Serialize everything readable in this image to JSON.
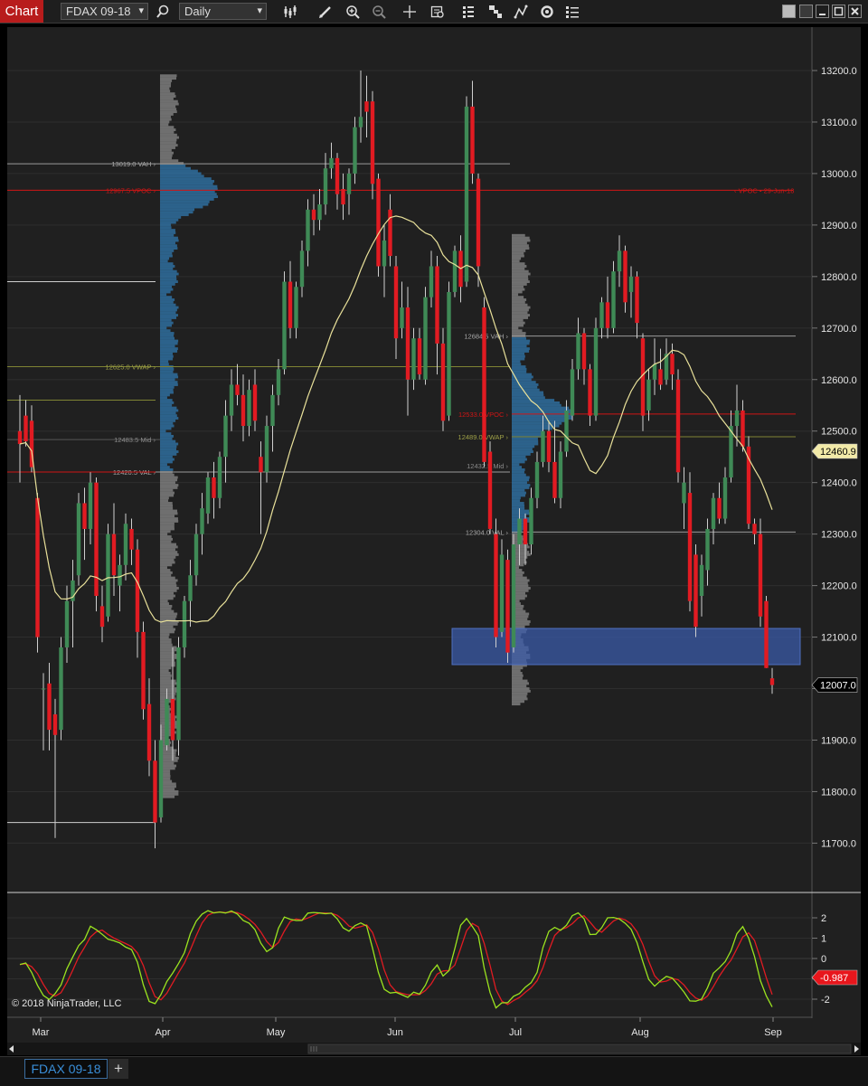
{
  "toolbar": {
    "chart_label": "Chart",
    "instrument": "FDAX 09-18",
    "interval": "Daily",
    "icons": [
      "search-icon",
      "bar-type-icon",
      "pencil-icon",
      "zoom-in-icon",
      "zoom-out-icon",
      "crosshair-icon",
      "data-box-icon",
      "strategies-icon",
      "indicators-icon",
      "drawing-tools-icon",
      "reload-icon",
      "properties-icon"
    ]
  },
  "window": {
    "buttons": [
      "tile-icon",
      "minimize-icon",
      "maximize-icon",
      "close-icon"
    ]
  },
  "tabs": [
    {
      "label": "FDAX 09-18"
    }
  ],
  "tab_add": "+",
  "colors": {
    "up": "#3f8a56",
    "down": "#e11b22",
    "sma": "#e9e19a",
    "vwap": "#7f8433",
    "poc": "#d01515",
    "value_area": "#2f6f9f",
    "zone": "#3a5aa7"
  },
  "chart_data": {
    "type": "candlestick",
    "interval": "Daily",
    "price_axis": {
      "ticks": [
        13200,
        13100,
        13000,
        12900,
        12800,
        12700,
        12600,
        12500,
        12400,
        12300,
        12200,
        12100,
        12000,
        11900,
        11800,
        11700
      ],
      "labels": [
        "13200.0",
        "13100.0",
        "13000.0",
        "12900.0",
        "12800.0",
        "12700.0",
        "12600.0",
        "12500.0",
        "12400.0",
        "12300.0",
        "12200.0",
        "12100.0",
        "12000.0",
        "11900.0",
        "11800.0",
        "11700.0"
      ]
    },
    "time_axis": {
      "labels": [
        "Mar",
        "Apr",
        "May",
        "Jun",
        "Jul",
        "Aug",
        "Sep"
      ]
    },
    "markers": {
      "ma_value": "12460.9",
      "last_price": "12007.0",
      "oscillator_value": "-0.987"
    },
    "profile_labels": {
      "p1_vah": "13019.0 VAH",
      "p1_vpoc": "12967.5 VPOC",
      "p1_vwap": "12625.0 VWAP",
      "p1_mid": "12483.5 Mid",
      "p1_val": "12420.5 VAL",
      "p2_vah": "12684.5 VAH",
      "p2_vpoc": "12533.0 VPOC",
      "p2_vwap": "12489.0 VWAP",
      "p2_mid": "12432.5 Mid",
      "p2_val": "12304.0 VAL",
      "naked_vpoc": "VPOC • 29-Jun-18"
    },
    "oscillator_axis": {
      "ticks": [
        2,
        1,
        0,
        -1,
        -2
      ],
      "labels": [
        "2",
        "1",
        "0",
        "-1",
        "-2"
      ]
    },
    "copyright": "© 2018 NinjaTrader, LLC",
    "candles": [
      {
        "o": 12500,
        "h": 12570,
        "l": 12400,
        "c": 12475
      },
      {
        "o": 12530,
        "h": 12560,
        "l": 12470,
        "c": 12480
      },
      {
        "o": 12520,
        "h": 12550,
        "l": 12420,
        "c": 12430
      },
      {
        "o": 12370,
        "h": 12380,
        "l": 12070,
        "c": 12100
      },
      {
        "o": 12000,
        "h": 12030,
        "l": 11880,
        "c": 12000
      },
      {
        "o": 12010,
        "h": 12050,
        "l": 11880,
        "c": 11920
      },
      {
        "o": 11950,
        "h": 11980,
        "l": 11710,
        "c": 11910
      },
      {
        "o": 11920,
        "h": 12100,
        "l": 11900,
        "c": 12080
      },
      {
        "o": 12080,
        "h": 12200,
        "l": 12050,
        "c": 12170
      },
      {
        "o": 12170,
        "h": 12250,
        "l": 12080,
        "c": 12210
      },
      {
        "o": 12220,
        "h": 12380,
        "l": 12200,
        "c": 12360
      },
      {
        "o": 12360,
        "h": 12390,
        "l": 12250,
        "c": 12310
      },
      {
        "o": 12310,
        "h": 12420,
        "l": 12280,
        "c": 12400
      },
      {
        "o": 12400,
        "h": 12410,
        "l": 12150,
        "c": 12180
      },
      {
        "o": 12160,
        "h": 12200,
        "l": 12090,
        "c": 12120
      },
      {
        "o": 12140,
        "h": 12320,
        "l": 12130,
        "c": 12300
      },
      {
        "o": 12300,
        "h": 12360,
        "l": 12180,
        "c": 12220
      },
      {
        "o": 12200,
        "h": 12260,
        "l": 12150,
        "c": 12240
      },
      {
        "o": 12240,
        "h": 12340,
        "l": 12210,
        "c": 12320
      },
      {
        "o": 12310,
        "h": 12330,
        "l": 12240,
        "c": 12270
      },
      {
        "o": 12270,
        "h": 12290,
        "l": 12060,
        "c": 12110
      },
      {
        "o": 12110,
        "h": 12130,
        "l": 11940,
        "c": 11960
      },
      {
        "o": 11970,
        "h": 12020,
        "l": 11830,
        "c": 11860
      },
      {
        "o": 11860,
        "h": 11900,
        "l": 11690,
        "c": 11740
      },
      {
        "o": 11750,
        "h": 11930,
        "l": 11740,
        "c": 11900
      },
      {
        "o": 11890,
        "h": 12000,
        "l": 11880,
        "c": 11980
      },
      {
        "o": 11980,
        "h": 12080,
        "l": 11860,
        "c": 11900
      },
      {
        "o": 11900,
        "h": 12100,
        "l": 11870,
        "c": 12080
      },
      {
        "o": 12080,
        "h": 12180,
        "l": 12060,
        "c": 12170
      },
      {
        "o": 12170,
        "h": 12250,
        "l": 12120,
        "c": 12220
      },
      {
        "o": 12220,
        "h": 12320,
        "l": 12200,
        "c": 12300
      },
      {
        "o": 12300,
        "h": 12380,
        "l": 12260,
        "c": 12350
      },
      {
        "o": 12340,
        "h": 12420,
        "l": 12320,
        "c": 12410
      },
      {
        "o": 12410,
        "h": 12440,
        "l": 12330,
        "c": 12370
      },
      {
        "o": 12370,
        "h": 12460,
        "l": 12350,
        "c": 12450
      },
      {
        "o": 12450,
        "h": 12560,
        "l": 12400,
        "c": 12530
      },
      {
        "o": 12530,
        "h": 12620,
        "l": 12500,
        "c": 12590
      },
      {
        "o": 12590,
        "h": 12630,
        "l": 12550,
        "c": 12570
      },
      {
        "o": 12570,
        "h": 12610,
        "l": 12480,
        "c": 12510
      },
      {
        "o": 12510,
        "h": 12600,
        "l": 12490,
        "c": 12580
      },
      {
        "o": 12590,
        "h": 12620,
        "l": 12500,
        "c": 12520
      },
      {
        "o": 12450,
        "h": 12480,
        "l": 12300,
        "c": 12420
      },
      {
        "o": 12420,
        "h": 12530,
        "l": 12400,
        "c": 12510
      },
      {
        "o": 12510,
        "h": 12590,
        "l": 12460,
        "c": 12570
      },
      {
        "o": 12570,
        "h": 12640,
        "l": 12550,
        "c": 12620
      },
      {
        "o": 12620,
        "h": 12810,
        "l": 12610,
        "c": 12790
      },
      {
        "o": 12790,
        "h": 12830,
        "l": 12680,
        "c": 12700
      },
      {
        "o": 12700,
        "h": 12790,
        "l": 12680,
        "c": 12780
      },
      {
        "o": 12780,
        "h": 12870,
        "l": 12760,
        "c": 12850
      },
      {
        "o": 12850,
        "h": 12950,
        "l": 12820,
        "c": 12930
      },
      {
        "o": 12930,
        "h": 12960,
        "l": 12880,
        "c": 12910
      },
      {
        "o": 12910,
        "h": 12970,
        "l": 12890,
        "c": 12940
      },
      {
        "o": 12940,
        "h": 13040,
        "l": 12920,
        "c": 13010
      },
      {
        "o": 13010,
        "h": 13060,
        "l": 12990,
        "c": 13030
      },
      {
        "o": 13030,
        "h": 13040,
        "l": 12930,
        "c": 12960
      },
      {
        "o": 12970,
        "h": 13000,
        "l": 12910,
        "c": 12940
      },
      {
        "o": 12960,
        "h": 13010,
        "l": 12920,
        "c": 13000
      },
      {
        "o": 13000,
        "h": 13110,
        "l": 12980,
        "c": 13090
      },
      {
        "o": 13090,
        "h": 13200,
        "l": 13060,
        "c": 13110
      },
      {
        "o": 13140,
        "h": 13190,
        "l": 13070,
        "c": 13120
      },
      {
        "o": 13140,
        "h": 13160,
        "l": 12950,
        "c": 12980
      },
      {
        "o": 12990,
        "h": 13000,
        "l": 12800,
        "c": 12820
      },
      {
        "o": 12820,
        "h": 12900,
        "l": 12760,
        "c": 12870
      },
      {
        "o": 12930,
        "h": 12960,
        "l": 12820,
        "c": 12840
      },
      {
        "o": 12820,
        "h": 12840,
        "l": 12640,
        "c": 12680
      },
      {
        "o": 12700,
        "h": 12790,
        "l": 12680,
        "c": 12740
      },
      {
        "o": 12740,
        "h": 12780,
        "l": 12530,
        "c": 12600
      },
      {
        "o": 12600,
        "h": 12700,
        "l": 12580,
        "c": 12680
      },
      {
        "o": 12680,
        "h": 12700,
        "l": 12600,
        "c": 12610
      },
      {
        "o": 12600,
        "h": 12780,
        "l": 12590,
        "c": 12760
      },
      {
        "o": 12760,
        "h": 12850,
        "l": 12740,
        "c": 12820
      },
      {
        "o": 12820,
        "h": 12840,
        "l": 12610,
        "c": 12670
      },
      {
        "o": 12670,
        "h": 12700,
        "l": 12500,
        "c": 12520
      },
      {
        "o": 12530,
        "h": 12790,
        "l": 12520,
        "c": 12770
      },
      {
        "o": 12770,
        "h": 12860,
        "l": 12760,
        "c": 12850
      },
      {
        "o": 12850,
        "h": 12880,
        "l": 12750,
        "c": 12780
      },
      {
        "o": 12790,
        "h": 13150,
        "l": 12780,
        "c": 13130
      },
      {
        "o": 13130,
        "h": 13180,
        "l": 12980,
        "c": 13000
      },
      {
        "o": 12990,
        "h": 13000,
        "l": 12780,
        "c": 12820
      },
      {
        "o": 12740,
        "h": 12760,
        "l": 12430,
        "c": 12440
      },
      {
        "o": 12460,
        "h": 12480,
        "l": 12300,
        "c": 12310
      },
      {
        "o": 12300,
        "h": 12330,
        "l": 12080,
        "c": 12100
      },
      {
        "o": 12110,
        "h": 12290,
        "l": 12100,
        "c": 12260
      },
      {
        "o": 12250,
        "h": 12270,
        "l": 12050,
        "c": 12070
      },
      {
        "o": 12080,
        "h": 12300,
        "l": 12070,
        "c": 12280
      },
      {
        "o": 12280,
        "h": 12350,
        "l": 12240,
        "c": 12330
      },
      {
        "o": 12330,
        "h": 12340,
        "l": 12240,
        "c": 12280
      },
      {
        "o": 12280,
        "h": 12390,
        "l": 12260,
        "c": 12370
      },
      {
        "o": 12370,
        "h": 12460,
        "l": 12350,
        "c": 12440
      },
      {
        "o": 12440,
        "h": 12530,
        "l": 12430,
        "c": 12500
      },
      {
        "o": 12500,
        "h": 12520,
        "l": 12420,
        "c": 12440
      },
      {
        "o": 12440,
        "h": 12520,
        "l": 12360,
        "c": 12370
      },
      {
        "o": 12370,
        "h": 12480,
        "l": 12350,
        "c": 12460
      },
      {
        "o": 12460,
        "h": 12560,
        "l": 12450,
        "c": 12540
      },
      {
        "o": 12530,
        "h": 12640,
        "l": 12520,
        "c": 12620
      },
      {
        "o": 12620,
        "h": 12720,
        "l": 12600,
        "c": 12690
      },
      {
        "o": 12690,
        "h": 12700,
        "l": 12590,
        "c": 12620
      },
      {
        "o": 12620,
        "h": 12630,
        "l": 12510,
        "c": 12530
      },
      {
        "o": 12530,
        "h": 12720,
        "l": 12520,
        "c": 12700
      },
      {
        "o": 12700,
        "h": 12760,
        "l": 12680,
        "c": 12750
      },
      {
        "o": 12750,
        "h": 12800,
        "l": 12680,
        "c": 12700
      },
      {
        "o": 12700,
        "h": 12830,
        "l": 12690,
        "c": 12810
      },
      {
        "o": 12810,
        "h": 12880,
        "l": 12780,
        "c": 12850
      },
      {
        "o": 12850,
        "h": 12860,
        "l": 12730,
        "c": 12750
      },
      {
        "o": 12770,
        "h": 12820,
        "l": 12720,
        "c": 12800
      },
      {
        "o": 12800,
        "h": 12810,
        "l": 12680,
        "c": 12710
      },
      {
        "o": 12680,
        "h": 12690,
        "l": 12500,
        "c": 12530
      },
      {
        "o": 12540,
        "h": 12620,
        "l": 12520,
        "c": 12600
      },
      {
        "o": 12600,
        "h": 12680,
        "l": 12570,
        "c": 12630
      },
      {
        "o": 12620,
        "h": 12660,
        "l": 12580,
        "c": 12590
      },
      {
        "o": 12600,
        "h": 12680,
        "l": 12590,
        "c": 12650
      },
      {
        "o": 12650,
        "h": 12670,
        "l": 12580,
        "c": 12610
      },
      {
        "o": 12600,
        "h": 12620,
        "l": 12400,
        "c": 12420
      },
      {
        "o": 12360,
        "h": 12430,
        "l": 12310,
        "c": 12400
      },
      {
        "o": 12380,
        "h": 12420,
        "l": 12150,
        "c": 12170
      },
      {
        "o": 12260,
        "h": 12280,
        "l": 12100,
        "c": 12120
      },
      {
        "o": 12180,
        "h": 12260,
        "l": 12140,
        "c": 12240
      },
      {
        "o": 12230,
        "h": 12330,
        "l": 12200,
        "c": 12310
      },
      {
        "o": 12310,
        "h": 12380,
        "l": 12280,
        "c": 12370
      },
      {
        "o": 12370,
        "h": 12400,
        "l": 12320,
        "c": 12330
      },
      {
        "o": 12330,
        "h": 12430,
        "l": 12320,
        "c": 12410
      },
      {
        "o": 12410,
        "h": 12540,
        "l": 12400,
        "c": 12510
      },
      {
        "o": 12510,
        "h": 12590,
        "l": 12470,
        "c": 12540
      },
      {
        "o": 12540,
        "h": 12560,
        "l": 12460,
        "c": 12470
      },
      {
        "o": 12470,
        "h": 12490,
        "l": 12310,
        "c": 12320
      },
      {
        "o": 12320,
        "h": 12330,
        "l": 12280,
        "c": 12300
      },
      {
        "o": 12300,
        "h": 12330,
        "l": 12120,
        "c": 12140
      },
      {
        "o": 12170,
        "h": 12180,
        "l": 12040,
        "c": 12040
      },
      {
        "o": 12020,
        "h": 12040,
        "l": 11990,
        "c": 12007
      }
    ]
  }
}
